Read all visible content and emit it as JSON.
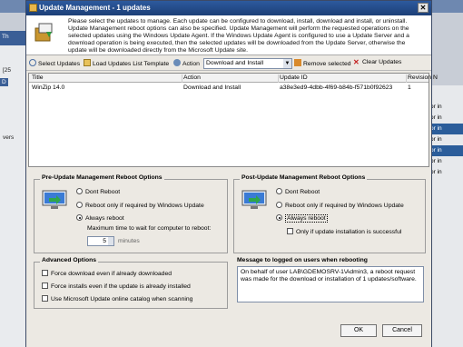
{
  "background": {
    "left_items": [
      "Th",
      "[25",
      "D",
      "vers"
    ],
    "right_items": [
      "or in",
      "or in",
      "or in",
      "or in",
      "or in",
      "or in",
      "or in"
    ]
  },
  "dialog": {
    "title": "Update Management - 1 updates",
    "description": "Please select the updates to manage. Each update can be configured to download, install, download and install, or uninstall. Update Management reboot options can also be specified. Update Management will perform the requested operations on the selected updates using the Windows Update Agent. If the Windows Update Agent is configured to use a Update Server and a download operation is being executed, then the selected updates will be downloaded from the Update Server, otherwise the update will be downloaded directly from the Microsoft Update site."
  },
  "toolbar": {
    "select_updates": "Select Updates",
    "load_updates": "Load Updates List Template",
    "action_label": "Action",
    "action_value": "Download and Install",
    "remove_selected": "Remove selected",
    "clear_updates": "Clear Updates"
  },
  "grid": {
    "columns": [
      "Title",
      "Action",
      "Update ID",
      "Revision N"
    ],
    "rows": [
      [
        "WinZip 14.0",
        "Download and Install",
        "a38e3ed9-4dbb-4f69-b84b-f571b0f92623",
        "1"
      ]
    ]
  },
  "pre_reboot": {
    "title": "Pre-Update Management Reboot Options",
    "options": [
      "Dont Reboot",
      "Reboot only if required by Windows Update",
      "Always reboot"
    ],
    "selected": 2,
    "wait_label": "Maximum time to wait for computer to reboot:",
    "wait_value": "5",
    "wait_unit": "minutes"
  },
  "post_reboot": {
    "title": "Post-Update Management Reboot Options",
    "options": [
      "Dont Reboot",
      "Reboot only if required by Windows Update",
      "Always reboot"
    ],
    "selected": 2,
    "only_if_success": "Only if update installation is successful"
  },
  "advanced": {
    "title": "Advanced Options",
    "options": [
      "Force download even if already downloaded",
      "Force installs even if the update is already installed",
      "Use Microsoft Update online catalog when scanning"
    ]
  },
  "message": {
    "title": "Message to logged on users when rebooting",
    "text": "On behalf of user LAB\\GDEMOSRV-1\\Admin3, a reboot request was made for the download or installation of 1 updates/software."
  },
  "buttons": {
    "ok": "OK",
    "cancel": "Cancel"
  }
}
